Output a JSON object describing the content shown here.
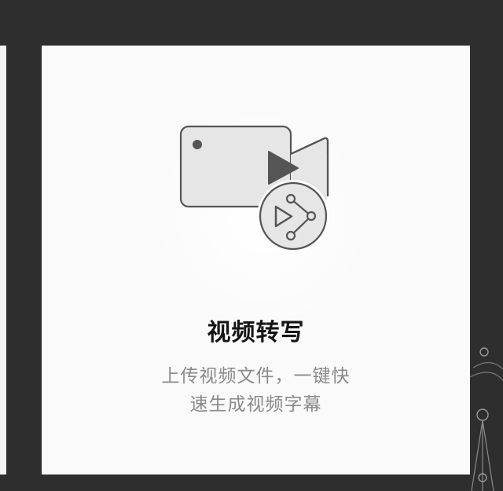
{
  "card": {
    "title": "视频转写",
    "description_line1": "上传视频文件，一键快",
    "description_line2": "速生成视频字幕"
  },
  "icons": {
    "hero": "video-camera-icon",
    "badge": "share-play-icon"
  },
  "colors": {
    "background": "#2e2e2e",
    "card": "#fafafa",
    "icon_fill": "#e6e6e6",
    "icon_stroke": "#555555",
    "title": "#151515",
    "description": "#8a8a8a"
  }
}
